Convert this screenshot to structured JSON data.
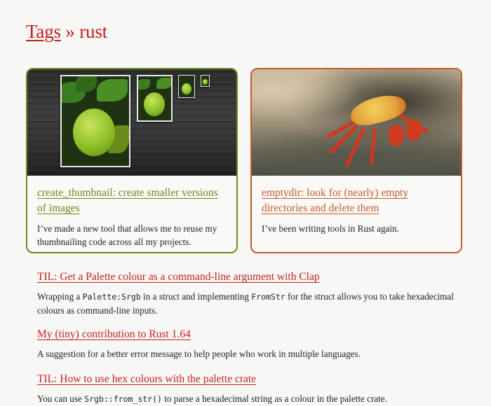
{
  "header": {
    "breadcrumb_link": "Tags",
    "separator": "»",
    "tag": "rust"
  },
  "cards": [
    {
      "image_alt": "Lime photo repeated at decreasing thumbnail sizes on dark wood background",
      "title": "create_thumbnail: create smaller versions of images",
      "summary": "I’ve made a new tool that allows me to reuse my thumbnailing code across all my projects.",
      "accent": "#6f8a1d"
    },
    {
      "image_alt": "Red crab on a rock",
      "title": "emptydir: look for (nearly) empty directories and delete them",
      "summary": "I’ve been writing tools in Rust again.",
      "accent": "#c45a29"
    }
  ],
  "posts": [
    {
      "title": "TIL: Get a Palette colour as a command-line argument with Clap",
      "summary_parts": [
        "Wrapping a ",
        "Palette:Srgb",
        " in a struct and implementing ",
        "FromStr",
        " for the struct allows you to take hexadecimal colours as command-line inputs."
      ]
    },
    {
      "title": "My (tiny) contribution to Rust 1.64",
      "summary": "A suggestion for a better error message to help people who work in multiple languages."
    },
    {
      "title": "TIL: How to use hex colours with the palette crate",
      "summary_parts": [
        "You can use ",
        "Srgb::from_str()",
        " to parse a hexadecimal string as a colour in the palette crate."
      ]
    }
  ],
  "colors": {
    "link_red": "#c31f18",
    "green_accent": "#6f8a1d",
    "orange_accent": "#c45a29",
    "background": "#f7f7f6"
  }
}
